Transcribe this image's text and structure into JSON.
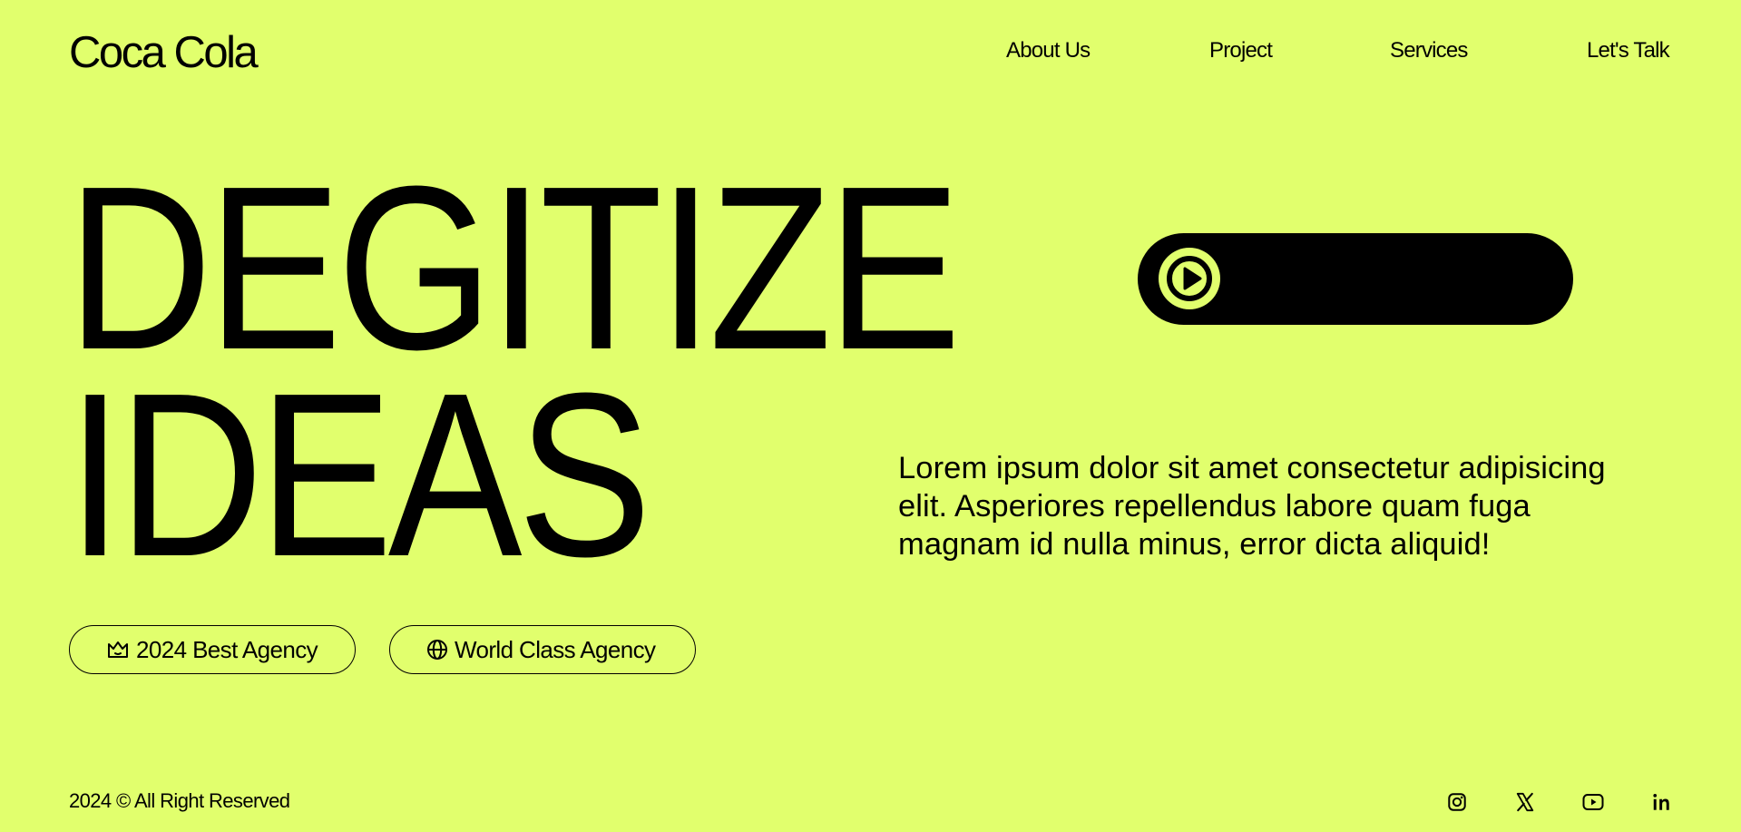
{
  "brand": {
    "logo_text": "Coca Cola"
  },
  "nav": {
    "items": [
      {
        "label": "About Us"
      },
      {
        "label": "Project"
      },
      {
        "label": "Services"
      },
      {
        "label": "Let's Talk"
      }
    ]
  },
  "hero": {
    "headline_line1": "DEGITIZE",
    "headline_line2": "IDEAS",
    "description": "Lorem ipsum dolor sit amet consectetur adipisicing elit. Asperiores repellendus labore quam fuga magnam id nulla minus, error dicta aliquid!",
    "video_button_icon": "play-icon"
  },
  "badges": [
    {
      "label": "2024 Best Agency",
      "icon": "crown-icon"
    },
    {
      "label": "World Class Agency",
      "icon": "globe-icon"
    }
  ],
  "footer": {
    "copyright": "2024 © All Right Reserved",
    "social": [
      {
        "icon": "instagram-icon"
      },
      {
        "icon": "x-icon"
      },
      {
        "icon": "youtube-icon"
      },
      {
        "icon": "linkedin-icon"
      }
    ]
  },
  "colors": {
    "background": "#e1ff6d",
    "foreground": "#000000"
  }
}
